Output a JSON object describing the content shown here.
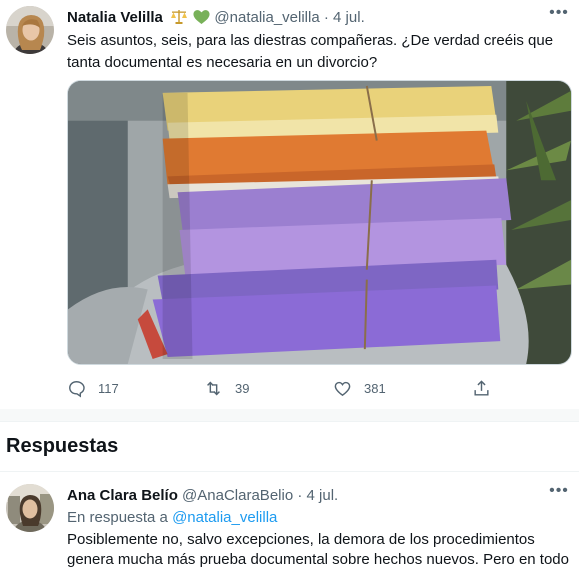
{
  "tweet": {
    "author_name": "Natalia Velilla",
    "author_handle": "@natalia_velilla",
    "separator": "·",
    "date": "4 jul.",
    "emojis": [
      "balance-scale-emoji",
      "green-heart-emoji"
    ],
    "text": "Seis asuntos, seis, para las diestras compañeras. ¿De verdad creéis que tanta documental es necesaria en un divorcio?",
    "media_icon": "photo-of-stacked-case-files",
    "actions": {
      "reply_count": "117",
      "retweet_count": "39",
      "like_count": "381"
    }
  },
  "section_title": "Respuestas",
  "reply": {
    "author_name": "Ana Clara Belío",
    "author_handle": "@AnaClaraBelio",
    "separator": "·",
    "date": "4 jul.",
    "reply_prefix": "En respuesta a",
    "reply_to_handle": "@natalia_velilla",
    "text": "Posiblemente no, salvo excepciones, la demora de los procedimientos genera mucha más prueba documental sobre hechos nuevos. Pero en todo"
  },
  "colors": {
    "text_primary": "#0f1419",
    "text_secondary": "#536471",
    "link": "#1d9bf0",
    "border": "#eff3f4"
  }
}
